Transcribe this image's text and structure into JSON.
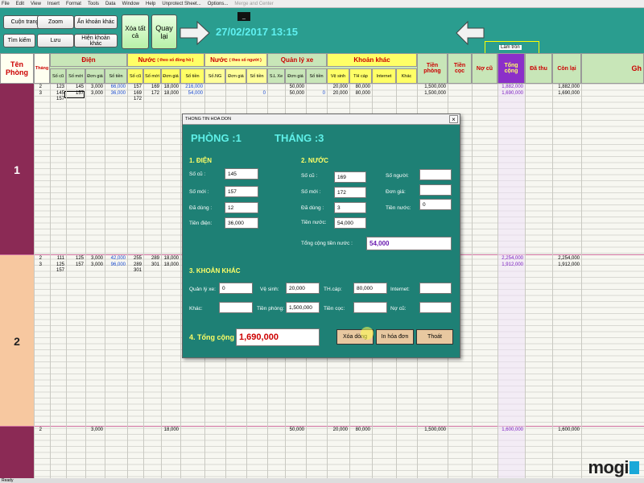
{
  "menu": [
    "File",
    "Edit",
    "View",
    "Insert",
    "Format",
    "Tools",
    "Data",
    "Window",
    "Help",
    "Unprotect Sheet...",
    "Options...",
    "Merge and Center"
  ],
  "toolbar": {
    "cuon_trang": "Cuộn trang",
    "zoom": "Zoom",
    "an_khoan_khac": "Ẩn khoản khác",
    "tim_kiem": "Tìm kiếm",
    "luu": "Lưu",
    "hien_khoan_khac": "Hiện khoản khác",
    "xoa_tat_ca": "Xóa tất cả",
    "quay_lai": "Quay lại",
    "datetime": "27/02/2017 13:15",
    "tooltip": "_",
    "lam_tron": "Làm tròn"
  },
  "header": {
    "ten_phong": "Tên Phòng",
    "thang": "Tháng",
    "dien": "Điện",
    "nuoc_dong_ho": "Nước",
    "nuoc_dong_ho_note": "( theo số đồng hồ )",
    "nuoc_nguoi": "Nước",
    "nuoc_nguoi_note": "( theo số người )",
    "quan_ly_xe": "Quản lý xe",
    "khoan_khac": "Khoản khác",
    "tien_phong": "Tiền phòng",
    "tien_coc": "Tiền cọc",
    "no_cu": "Nợ cũ",
    "tong_cong": "Tổng cộng",
    "da_thu": "Đã thu",
    "con_lai": "Còn lại",
    "ghi": "Gh",
    "sub": [
      "Số cũ",
      "Số mới",
      "Đơn giá",
      "Số tiền",
      "Số cũ",
      "Số mới",
      "Đơn giá",
      "Số tiền",
      "Số.NG",
      "Đơn giá",
      "Số tiền",
      "S.L Xe",
      "Đơn giá",
      "Số tiền",
      "Vệ sinh",
      "TH cáp",
      "Internet",
      "Khác"
    ]
  },
  "rooms": [
    {
      "name": "1",
      "rows": [
        [
          "2",
          "123",
          "145",
          "3,000",
          "66,000",
          "157",
          "169",
          "18,000",
          "216,000",
          "",
          "",
          "",
          "",
          "50,000",
          "",
          "20,000",
          "80,000",
          "",
          "",
          "1,500,000",
          "",
          "",
          "1,882,000",
          "",
          "1,882,000"
        ],
        [
          "3",
          "145",
          "157",
          "3,000",
          "36,000",
          "169",
          "172",
          "18,000",
          "54,000",
          "",
          "",
          "0",
          "",
          "50,000",
          "0",
          "20,000",
          "80,000",
          "",
          "",
          "1,500,000",
          "",
          "",
          "1,690,000",
          "",
          "1,690,000"
        ],
        [
          "",
          "157",
          "",
          "",
          "",
          "172",
          "",
          "",
          "",
          "",
          "",
          "",
          "",
          "",
          "",
          "",
          "",
          "",
          "",
          "",
          "",
          "",
          "",
          "",
          ""
        ]
      ]
    },
    {
      "name": "2",
      "rows": [
        [
          "2",
          "111",
          "125",
          "3,000",
          "42,000",
          "255",
          "289",
          "18,000",
          "",
          "",
          "",
          "",
          "",
          "",
          "",
          "",
          "",
          "",
          "",
          "",
          "",
          "",
          "2,254,000",
          "",
          "2,254,000"
        ],
        [
          "3",
          "125",
          "157",
          "3,000",
          "96,000",
          "289",
          "301",
          "18,000",
          "",
          "",
          "",
          "",
          "",
          "",
          "",
          "",
          "",
          "",
          "",
          "",
          "",
          "",
          "1,912,000",
          "",
          "1,912,000"
        ],
        [
          "",
          "157",
          "",
          "",
          "",
          "301",
          "",
          "",
          "",
          "",
          "",
          "",
          "",
          "",
          "",
          "",
          "",
          "",
          "",
          "",
          "",
          "",
          "",
          "",
          ""
        ]
      ]
    },
    {
      "name": "",
      "rows": [
        [
          "2",
          "",
          "",
          "3,000",
          "",
          "",
          "",
          "18,000",
          "",
          "",
          "",
          "",
          "",
          "50,000",
          "",
          "20,000",
          "80,000",
          "",
          "",
          "1,500,000",
          "",
          "",
          "1,600,000",
          "",
          "1,600,000"
        ]
      ]
    }
  ],
  "dialog": {
    "title": "THONG TIN HOA DON",
    "phong": "PHÒNG :1",
    "thang": "THÁNG :3",
    "dien_h": "1. ĐIỆN",
    "nuoc_h": "2. NƯỚC",
    "khac_h": "3. KHOẢN KHÁC",
    "tong_h": "4. Tổng cộng",
    "dien": {
      "so_cu_l": "Số cũ :",
      "so_cu": "145",
      "so_moi_l": "Số mới :",
      "so_moi": "157",
      "da_dung_l": "Đã dùng :",
      "da_dung": "12",
      "tien_l": "Tiền điện:",
      "tien": "36,000"
    },
    "nuoc": {
      "so_cu_l": "Số cũ :",
      "so_cu": "169",
      "so_moi_l": "Số mới :",
      "so_moi": "172",
      "da_dung_l": "Đã dùng :",
      "da_dung": "3",
      "tien_l": "Tiền nước:",
      "tien": "54,000",
      "so_nguoi_l": "Số người:",
      "so_nguoi": "",
      "don_gia_l": "Đơn giá:",
      "don_gia": "",
      "tien_nuoc2_l": "Tiền nước:",
      "tien_nuoc2": "0",
      "tong_l": "Tổng cộng tiền nước :",
      "tong": "54,000"
    },
    "khac": {
      "qlx_l": "Quản lý xe:",
      "qlx": "0",
      "ve_sinh_l": "Vệ sinh:",
      "ve_sinh": "20,000",
      "th_cap_l": "TH.cáp:",
      "th_cap": "80,000",
      "internet_l": "Internet:",
      "internet": "",
      "khac_l": "Khác:",
      "khac": "",
      "tien_phong_l": "Tiền phòng:",
      "tien_phong": "1,500,000",
      "tien_coc_l": "Tiền cọc:",
      "tien_coc": "",
      "no_cu_l": "Nợ cũ:",
      "no_cu": ""
    },
    "tong": "1,690,000",
    "btn_xoa": "Xóa dòng",
    "btn_in": "In hóa đơn",
    "btn_thoat": "Thoát"
  },
  "status": "Ready",
  "logo": "mogi"
}
